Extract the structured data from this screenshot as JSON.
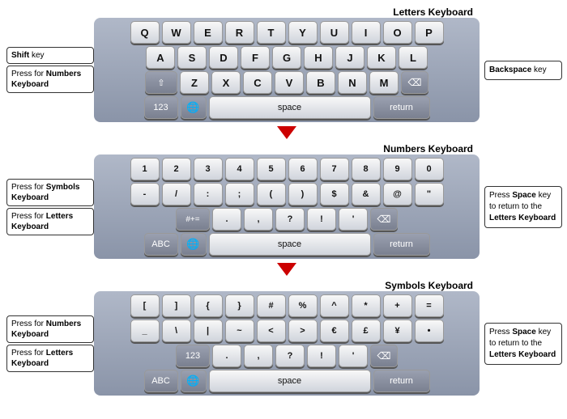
{
  "keyboards": [
    {
      "id": "letters",
      "title": "Letters Keyboard",
      "rows": [
        [
          "Q",
          "W",
          "E",
          "R",
          "T",
          "Y",
          "U",
          "I",
          "O",
          "P"
        ],
        [
          "A",
          "S",
          "D",
          "F",
          "G",
          "H",
          "J",
          "K",
          "L"
        ],
        [
          "⇧",
          "Z",
          "X",
          "C",
          "V",
          "B",
          "N",
          "M",
          "⌫"
        ],
        [
          "123",
          "🌐",
          "space",
          "return"
        ]
      ],
      "left_labels": [
        {
          "text": "Shift key",
          "bold_part": "Shift"
        },
        {
          "text": "Press for Numbers Keyboard",
          "bold_part": "Numbers Keyboard"
        }
      ],
      "right_labels": [
        {
          "text": "Backspace key",
          "bold_part": "Backspace"
        }
      ]
    },
    {
      "id": "numbers",
      "title": "Numbers Keyboard",
      "rows": [
        [
          "1",
          "2",
          "3",
          "4",
          "5",
          "6",
          "7",
          "8",
          "9",
          "0"
        ],
        [
          "-",
          "/",
          ":",
          ";",
          "(",
          ")",
          "$",
          "&",
          "@",
          "\""
        ],
        [
          "#+=",
          ".",
          ",",
          "?",
          "!",
          "'",
          "⌫"
        ],
        [
          "ABC",
          "🌐",
          "space",
          "return"
        ]
      ],
      "left_labels": [
        {
          "text": "Press for Symbols Keyboard",
          "bold_part": "Symbols Keyboard"
        },
        {
          "text": "Press for Letters Keyboard",
          "bold_part": "Letters Keyboard"
        }
      ],
      "right_labels": [
        {
          "text": "Press Space key to return to the Letters Keyboard",
          "bold_part": "Space"
        }
      ]
    },
    {
      "id": "symbols",
      "title": "Symbols Keyboard",
      "rows": [
        [
          "[",
          "]",
          "{",
          "}",
          "#",
          "%",
          "^",
          "*",
          "+",
          "="
        ],
        [
          "_",
          "\\",
          "|",
          "~",
          "<",
          ">",
          "€",
          "£",
          "¥",
          "•"
        ],
        [
          "123",
          ".",
          ",",
          "?",
          "!",
          "'",
          "⌫"
        ],
        [
          "ABC",
          "🌐",
          "space",
          "return"
        ]
      ],
      "left_labels": [
        {
          "text": "Press for Numbers Keyboard",
          "bold_part": "Numbers Keyboard"
        },
        {
          "text": "Press for Letters Keyboard",
          "bold_part": "Letters Keyboard"
        }
      ],
      "right_labels": [
        {
          "text": "Press Space key to return to the Letters Keyboard",
          "bold_part": "Space"
        }
      ]
    }
  ]
}
